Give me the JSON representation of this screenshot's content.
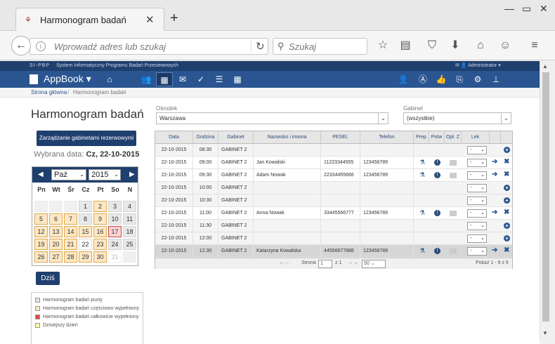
{
  "browser": {
    "tab_title": "Harmonogram badań",
    "url_placeholder": "Wprowadź adres lub szukaj",
    "search_placeholder": "Szukaj"
  },
  "app": {
    "brand": "SI-PBP",
    "subtitle": "System Informatyczny Programu Badań Przesiewowych",
    "user": "Administrator",
    "name": "AppBook",
    "breadcrumb_home": "Strona główna",
    "breadcrumb_current": "Harmonogram badań"
  },
  "left": {
    "title": "Harmonogram badań",
    "manage_button": "Zarządzanie gabinetami rezerwowymi",
    "selected_label": "Wybrana data:",
    "selected_value": "Cz, 22-10-2015",
    "today_button": "Dziś"
  },
  "calendar": {
    "month": "Paź",
    "year": "2015",
    "dow": [
      "Pn",
      "Wt",
      "Śr",
      "Cz",
      "Pt",
      "So",
      "N"
    ],
    "weeks": [
      [
        "",
        "",
        "",
        "1",
        "2",
        "3",
        "4"
      ],
      [
        "5",
        "6",
        "7",
        "8",
        "9",
        "10",
        "11"
      ],
      [
        "12",
        "13",
        "14",
        "15",
        "16",
        "17",
        "18"
      ],
      [
        "19",
        "20",
        "21",
        "22",
        "23",
        "24",
        "25"
      ],
      [
        "26",
        "27",
        "28",
        "29",
        "30",
        "31",
        ""
      ]
    ]
  },
  "legend": [
    {
      "label": "Harmonogram badań pusty",
      "color": "#e0e0e0"
    },
    {
      "label": "Harmonogram badań częściowo wypełniony",
      "color": "#fde8c4"
    },
    {
      "label": "Harmonogram badań całkowicie wypełniony",
      "color": "#e04848"
    },
    {
      "label": "Dzisiejszy dzień",
      "color": "#fff6a8"
    }
  ],
  "filters": {
    "osrodek_label": "Ośrodek",
    "osrodek_value": "Warszawa",
    "gabinet_label": "Gabinet",
    "gabinet_value": "(wszystkie)"
  },
  "table": {
    "columns": [
      "Data",
      "Godzina",
      "Gabinet",
      "Nazwisko i imiona",
      "PESEL",
      "Telefon",
      "Prep",
      "Potw",
      "Opł. Z",
      "Lek"
    ],
    "rows": [
      {
        "data": "22-10-2015",
        "godzina": "08:30",
        "gabinet": "GABINET 2",
        "nazwisko": "",
        "pesel": "",
        "telefon": "",
        "lek": "-",
        "booked": false
      },
      {
        "data": "22-10-2015",
        "godzina": "09:00",
        "gabinet": "GABINET 2",
        "nazwisko": "Jan Kowalski",
        "pesel": "11223344555",
        "telefon": "123456789",
        "lek": "-",
        "booked": true
      },
      {
        "data": "22-10-2015",
        "godzina": "09:30",
        "gabinet": "GABINET 2",
        "nazwisko": "Adam Nowak",
        "pesel": "22334455666",
        "telefon": "123456789",
        "lek": "-",
        "booked": true
      },
      {
        "data": "22-10-2015",
        "godzina": "10:00",
        "gabinet": "GABINET 2",
        "nazwisko": "",
        "pesel": "",
        "telefon": "",
        "lek": "-",
        "booked": false
      },
      {
        "data": "22-10-2015",
        "godzina": "10:30",
        "gabinet": "GABINET 2",
        "nazwisko": "",
        "pesel": "",
        "telefon": "",
        "lek": "-",
        "booked": false
      },
      {
        "data": "22-10-2015",
        "godzina": "11:00",
        "gabinet": "GABINET 2",
        "nazwisko": "Anna Nowak",
        "pesel": "33445566777",
        "telefon": "123456789",
        "lek": "-",
        "booked": true
      },
      {
        "data": "22-10-2015",
        "godzina": "11:30",
        "gabinet": "GABINET 2",
        "nazwisko": "",
        "pesel": "",
        "telefon": "",
        "lek": "-",
        "booked": false
      },
      {
        "data": "22-10-2015",
        "godzina": "12:00",
        "gabinet": "GABINET 2",
        "nazwisko": "",
        "pesel": "",
        "telefon": "",
        "lek": "-",
        "booked": false
      },
      {
        "data": "22-10-2015",
        "godzina": "12:30",
        "gabinet": "GABINET 2",
        "nazwisko": "Katarzyna Kowalska",
        "pesel": "44556677888",
        "telefon": "123456789",
        "lek": "-",
        "booked": true
      }
    ],
    "pager": {
      "page_label": "Strona",
      "page": "1",
      "of_label": "z 1",
      "page_size": "50",
      "summary": "Pokaż 1 - 9 z 9"
    }
  },
  "colors": {
    "brand_dark": "#1f3f6e",
    "brand_nav": "#2a5590",
    "partial": "#fde8c4",
    "today": "#fad4d4"
  }
}
